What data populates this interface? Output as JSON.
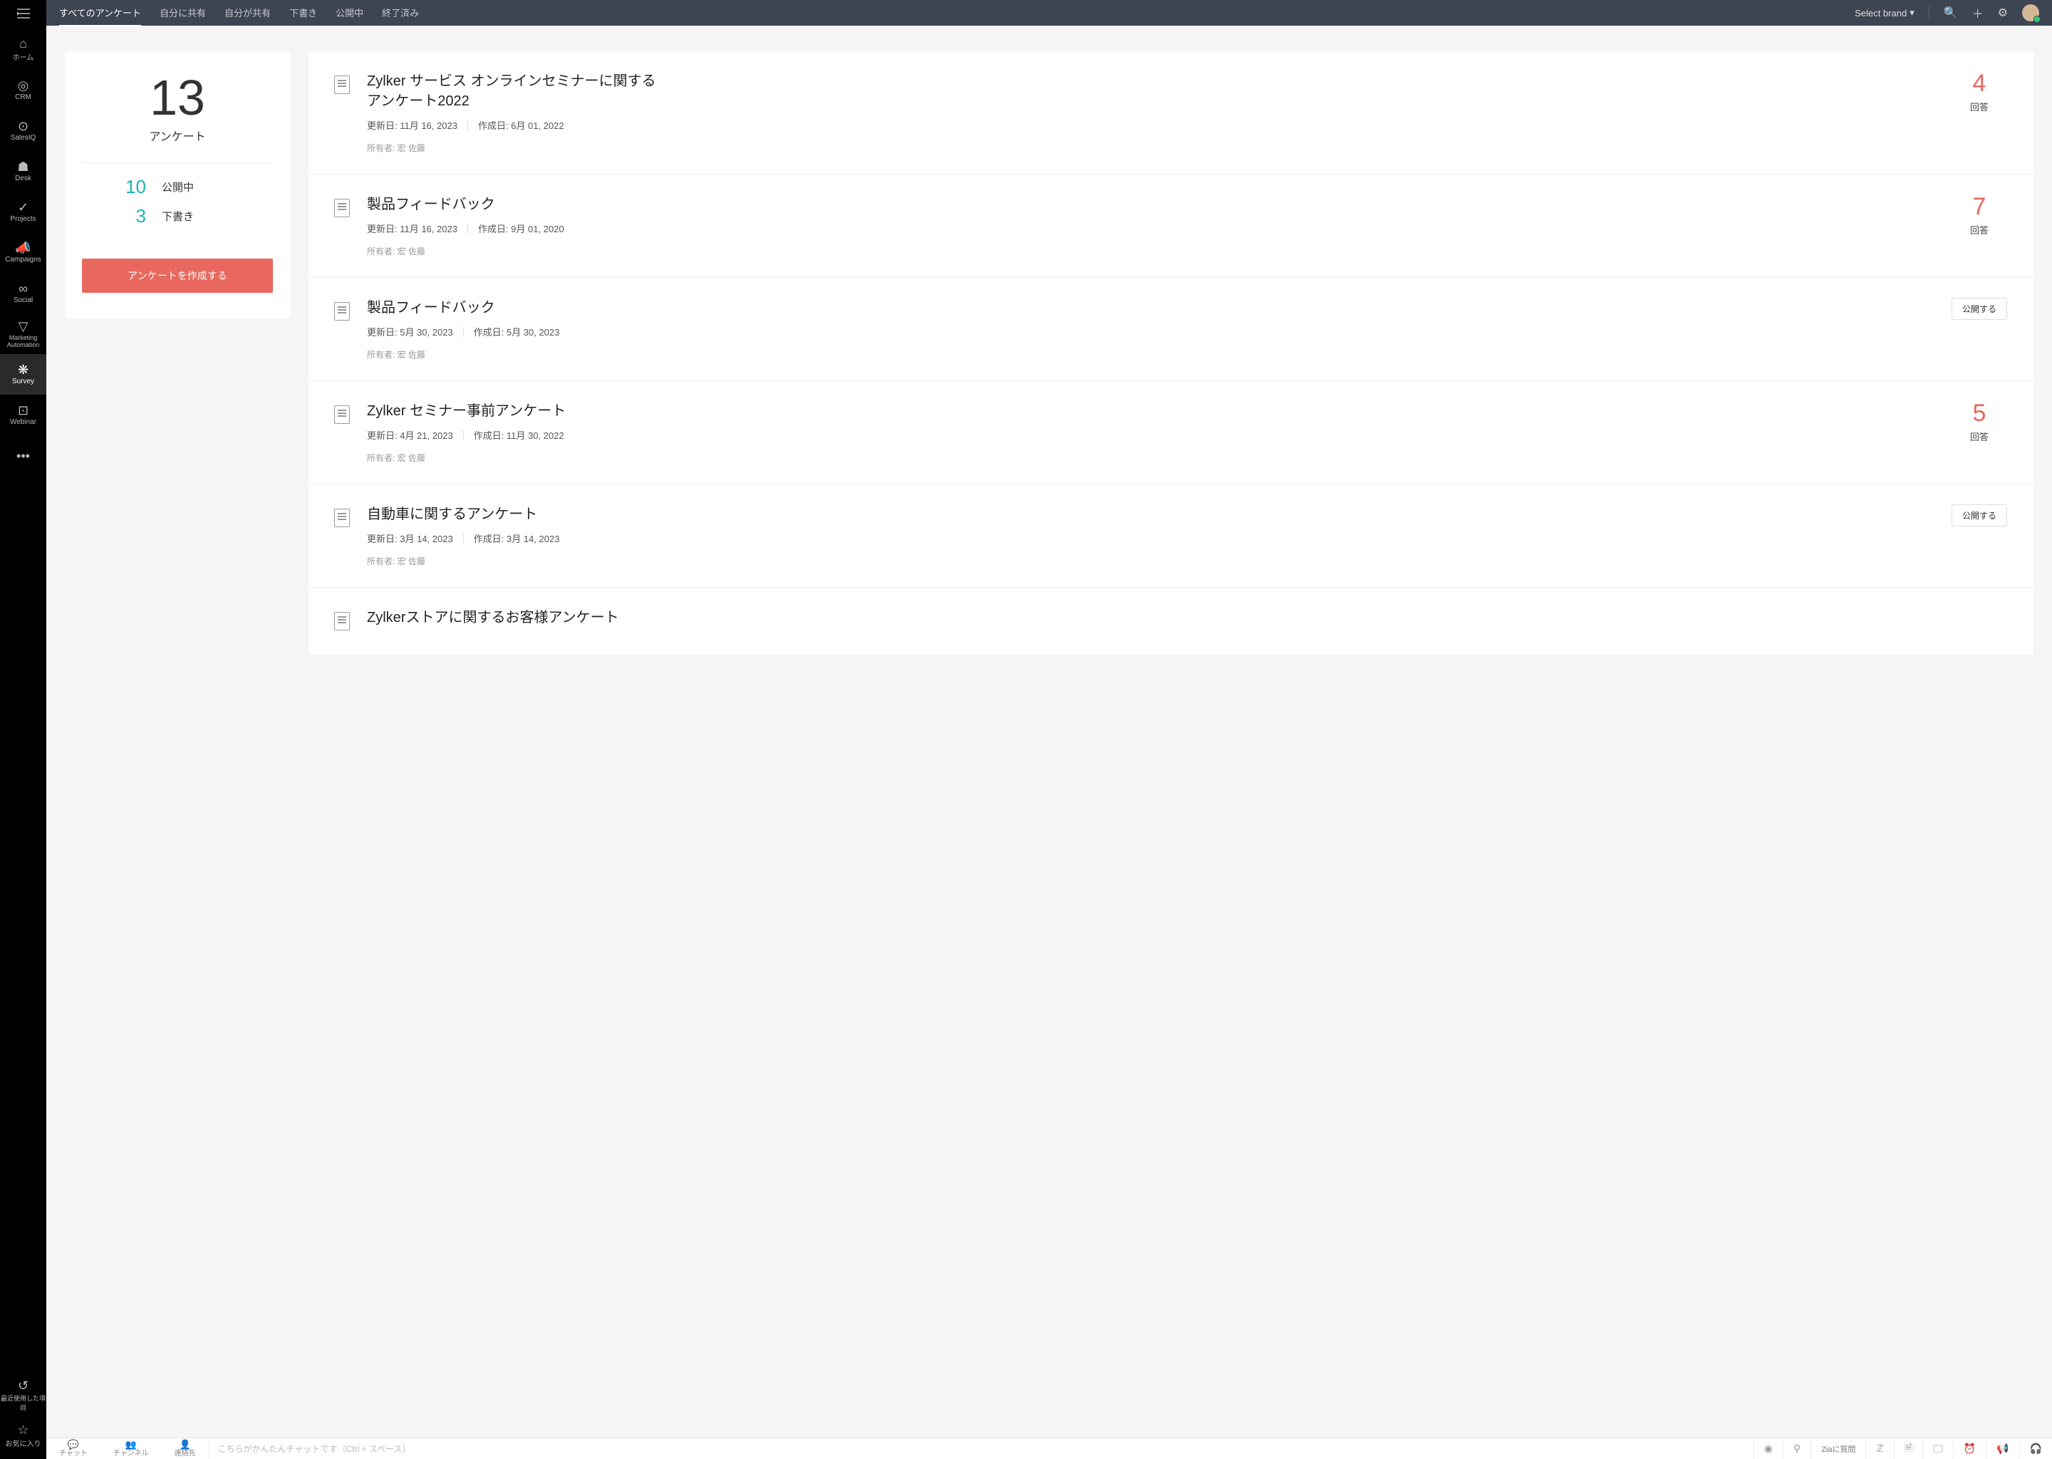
{
  "sidebar": {
    "items": [
      {
        "label": "ホーム"
      },
      {
        "label": "CRM"
      },
      {
        "label": "SalesIQ"
      },
      {
        "label": "Desk"
      },
      {
        "label": "Projects"
      },
      {
        "label": "Campaigns"
      },
      {
        "label": "Social"
      },
      {
        "label": "Marketing Automation"
      },
      {
        "label": "Survey"
      },
      {
        "label": "Webinar"
      }
    ],
    "recent": "最近使用した項目",
    "favorite": "お気に入り"
  },
  "topbar": {
    "tabs": [
      "すべてのアンケート",
      "自分に共有",
      "自分が共有",
      "下書き",
      "公開中",
      "終了済み"
    ],
    "brand": "Select brand"
  },
  "summary": {
    "total": "13",
    "total_label": "アンケート",
    "published_count": "10",
    "published_label": "公開中",
    "draft_count": "3",
    "draft_label": "下書き",
    "create_label": "アンケートを作成する"
  },
  "labels": {
    "updated": "更新日:",
    "created": "作成日:",
    "owner": "所有者:",
    "responses": "回答",
    "publish": "公開する"
  },
  "surveys": [
    {
      "title": "Zylker サービス オンラインセミナーに関するアンケート2022",
      "updated": "11月 16, 2023",
      "created": "6月 01, 2022",
      "owner": "宏 佐藤",
      "count": "4"
    },
    {
      "title": "製品フィードバック",
      "updated": "11月 16, 2023",
      "created": "9月 01, 2020",
      "owner": "宏 佐藤",
      "count": "7"
    },
    {
      "title": "製品フィードバック",
      "updated": "5月 30, 2023",
      "created": "5月 30, 2023",
      "owner": "宏 佐藤",
      "publish": true
    },
    {
      "title": "Zylker セミナー事前アンケート",
      "updated": "4月 21, 2023",
      "created": "11月 30, 2022",
      "owner": "宏 佐藤",
      "count": "5"
    },
    {
      "title": "自動車に関するアンケート",
      "updated": "3月 14, 2023",
      "created": "3月 14, 2023",
      "owner": "宏 佐藤",
      "publish": true
    },
    {
      "title": "Zylkerストアに関するお客様アンケート",
      "updated": "",
      "created": "",
      "owner": ""
    }
  ],
  "bottombar": {
    "items": [
      "チャット",
      "チャンネル",
      "連絡先"
    ],
    "placeholder": "こちらがかんたんチャットです（Ctrl + スペース）",
    "zia": "Ziaに質問"
  }
}
